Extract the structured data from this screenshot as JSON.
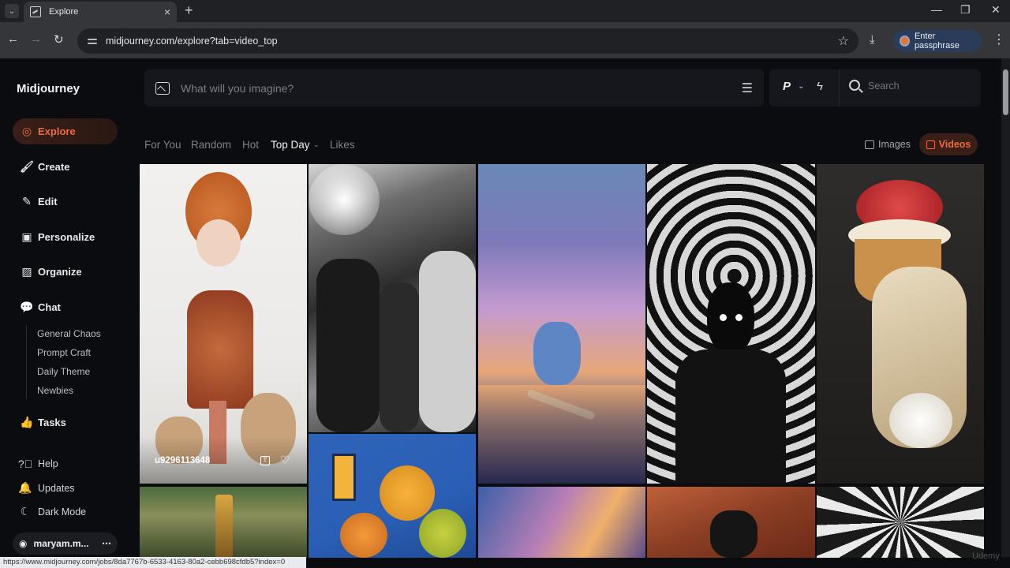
{
  "browser": {
    "tab_title": "Explore",
    "url": "midjourney.com/explore?tab=video_top",
    "passphrase_label": "Enter passphrase",
    "status_url": "https://www.midjourney.com/jobs/8da7767b-6533-4163-80a2-cebb698cfdb5?index=0"
  },
  "sidebar": {
    "logo": "Midjourney",
    "nav": [
      {
        "label": "Explore",
        "icon": "compass-icon"
      },
      {
        "label": "Create",
        "icon": "paintbrush-icon"
      },
      {
        "label": "Edit",
        "icon": "edit-icon"
      },
      {
        "label": "Personalize",
        "icon": "personalize-icon"
      },
      {
        "label": "Organize",
        "icon": "image-folder-icon"
      },
      {
        "label": "Chat",
        "icon": "chat-icon"
      }
    ],
    "chat_rooms": [
      "General Chaos",
      "Prompt Craft",
      "Daily Theme",
      "Newbies"
    ],
    "tasks": "Tasks",
    "footer": [
      "Help",
      "Updates",
      "Dark Mode"
    ],
    "user": "maryam.m..."
  },
  "prompt": {
    "placeholder": "What will you imagine?"
  },
  "tools": {
    "p_label": "P",
    "search_placeholder": "Search"
  },
  "filters": {
    "tabs": [
      "For You",
      "Random",
      "Hot",
      "Top Day",
      "Likes"
    ],
    "active": "Top Day",
    "media_images": "Images",
    "media_videos": "Videos"
  },
  "gallery": {
    "hover_tile_user": "u9296113648"
  },
  "watermark": "Udemy",
  "colors": {
    "accent": "#f06a3c",
    "background": "#0b0c10"
  }
}
